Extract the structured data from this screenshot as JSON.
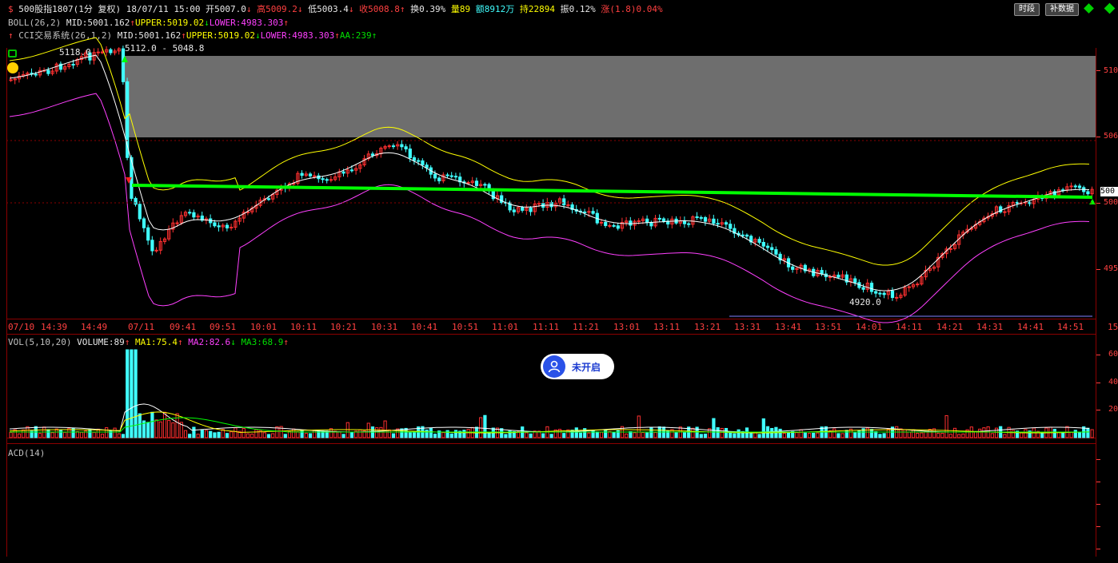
{
  "header": {
    "security": "500股指1807",
    "period": "(1分",
    "adjust": "复权)",
    "date": "18/07/11",
    "time": "15:00",
    "open_label": "开",
    "open_value": "5007.0",
    "open_arrow": "↓",
    "high_label": "高",
    "high_value": "5009.2",
    "high_arrow": "↓",
    "low_label": "低",
    "low_value": "5003.4",
    "low_arrow": "↓",
    "close_label": "收",
    "close_value": "5008.8",
    "close_arrow": "↑",
    "turnover_label": "换",
    "turnover_value": "0.39%",
    "volume_label": "量",
    "volume_value": "89",
    "amount_label": "额",
    "amount_value": "8912万",
    "position_label": "持",
    "position_value": "22894",
    "amplitude_label": "振",
    "amplitude_value": "0.12%",
    "change_label": "涨",
    "change_value": "(1.8)0.04%"
  },
  "buttons": {
    "time_segment": "时段",
    "supplement": "补数据"
  },
  "boll": {
    "name": "BOLL(26,2)",
    "mid": "MID:5001.162",
    "mid_arrow": "↑",
    "upper": "UPPER:5019.02",
    "upper_arrow": "↓",
    "lower": "LOWER:4983.303",
    "lower_arrow": "↑"
  },
  "cci": {
    "name": "CCI交易系统(26,1,2)",
    "mid": "MID:5001.162",
    "mid_arrow": "↑",
    "upper": "UPPER:5019.02",
    "upper_arrow": "↓",
    "lower": "LOWER:4983.303",
    "lower_arrow": "↑",
    "aa": "AA:239",
    "aa_arrow": "↑"
  },
  "annotations": {
    "peak_price": "5118.0",
    "range_text": "5112.0 - 5048.8",
    "trough_price": "4920.0"
  },
  "price_axis": [
    "510",
    "506",
    "500",
    "500",
    "495"
  ],
  "time_axis": [
    "07/10",
    "14:39",
    "14:49",
    "07/11",
    "09:41",
    "09:51",
    "10:01",
    "10:11",
    "10:21",
    "10:31",
    "10:41",
    "10:51",
    "11:01",
    "11:11",
    "11:21",
    "13:01",
    "13:11",
    "13:21",
    "13:31",
    "13:41",
    "13:51",
    "14:01",
    "14:11",
    "14:21",
    "14:31",
    "14:41",
    "14:51",
    "15"
  ],
  "volume": {
    "name": "VOL(5,10,20)",
    "value": "VOLUME:89",
    "value_arrow": "↑",
    "ma1": "MA1:75.4",
    "ma1_arrow": "↑",
    "ma2": "MA2:82.6",
    "ma2_arrow": "↓",
    "ma3": "MA3:68.9",
    "ma3_arrow": "↑",
    "axis": [
      "60",
      "40",
      "20"
    ]
  },
  "acd": {
    "name": "ACD(14)"
  },
  "badge": {
    "text": "未开启"
  },
  "colors": {
    "up": "#ff3030",
    "down": "#40ffff",
    "boll_mid": "#ffffff",
    "boll_upper": "#ffff00",
    "boll_lower": "#ff40ff",
    "trendline": "#00ff00",
    "frame": "#8b0000"
  }
}
